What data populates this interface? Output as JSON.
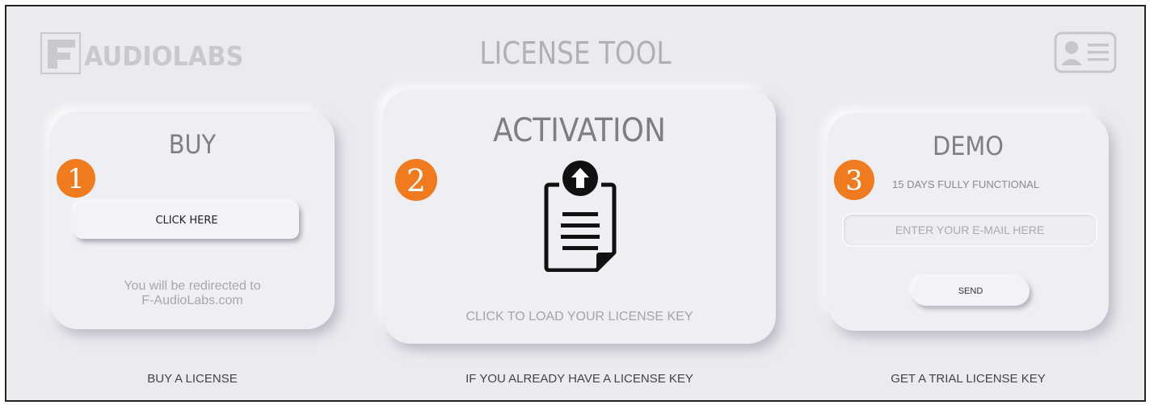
{
  "header": {
    "logo_text": "AUDIOLABS",
    "title": "LICENSE TOOL"
  },
  "buy": {
    "title": "BUY",
    "step": "1",
    "button_label": "CLICK HERE",
    "redirect_line1": "You will be redirected to",
    "redirect_line2": "F-AudioLabs.com",
    "caption": "BUY A LICENSE"
  },
  "activation": {
    "title": "ACTIVATION",
    "step": "2",
    "hint": "CLICK TO LOAD YOUR LICENSE KEY",
    "caption": "IF YOU ALREADY HAVE A LICENSE KEY",
    "icon": "clipboard-upload-icon"
  },
  "demo": {
    "title": "DEMO",
    "step": "3",
    "subtitle": "15 DAYS FULLY FUNCTIONAL",
    "email_placeholder": "ENTER YOUR E-MAIL HERE",
    "email_value": "",
    "send_label": "SEND",
    "caption": "GET A TRIAL LICENSE KEY"
  },
  "icons": {
    "logo": "f-audiolabs-logo-icon",
    "profile": "id-card-icon"
  },
  "colors": {
    "background": "#eaebef",
    "accent": "#f07a1e",
    "title_text": "#b0b1b5"
  }
}
